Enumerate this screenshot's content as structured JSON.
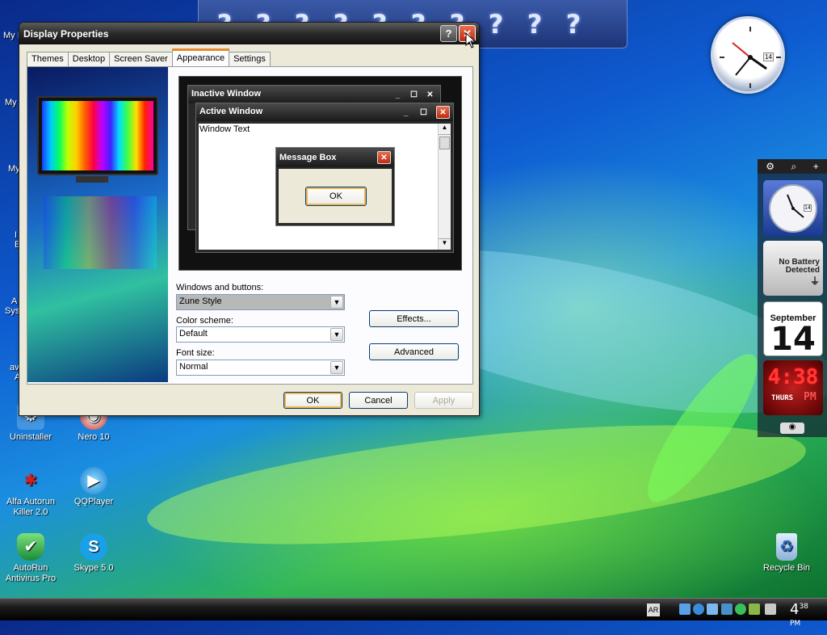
{
  "dialog": {
    "title": "Display Properties",
    "help_glyph": "?",
    "close_glyph": "✕",
    "tabs": [
      {
        "label": "Themes"
      },
      {
        "label": "Desktop"
      },
      {
        "label": "Screen Saver"
      },
      {
        "label": "Appearance",
        "active": true
      },
      {
        "label": "Settings"
      }
    ],
    "preview": {
      "inactive_title": "Inactive Window",
      "active_title": "Active Window",
      "window_text": "Window Text",
      "messagebox_title": "Message Box",
      "messagebox_ok": "OK"
    },
    "windows_buttons": {
      "label": "Windows and buttons:",
      "value": "Zune Style"
    },
    "color_scheme": {
      "label": "Color scheme:",
      "value": "Default"
    },
    "font_size": {
      "label": "Font size:",
      "value": "Normal"
    },
    "effects_label": "Effects...",
    "advanced_label": "Advanced",
    "ok_label": "OK",
    "cancel_label": "Cancel",
    "apply_label": "Apply"
  },
  "topbar": {
    "glyphs": [
      "?",
      "?",
      "?",
      "?",
      "?",
      "?",
      "?",
      "?",
      "?",
      "?"
    ]
  },
  "desktop_icons": [
    {
      "label": "Uninstaller",
      "icon": "uninstaller-icon"
    },
    {
      "label": "Nero 10",
      "icon": "nero-icon"
    },
    {
      "label": "Alfa Autorun Killer 2.0",
      "icon": "alfa-autorun-icon"
    },
    {
      "label": "QQPlayer",
      "icon": "qqplayer-icon"
    },
    {
      "label": "AutoRun Antivirus Pro",
      "icon": "autorun-antivirus-icon"
    },
    {
      "label": "Skype 5.0",
      "icon": "skype-icon"
    },
    {
      "label": "Recycle Bin",
      "icon": "recycle-bin-icon"
    }
  ],
  "cut_labels": [
    "My I",
    "My",
    "My",
    "I",
    "E",
    "A",
    "Sys",
    "av",
    "A"
  ],
  "gadgets": {
    "clock_date": "14",
    "battery_text": "No Battery Detected",
    "calendar_month": "September",
    "calendar_day": "14",
    "digital_time": "4:38",
    "digital_day": "THURS",
    "digital_ampm": "PM"
  },
  "taskbar": {
    "lang": "AR",
    "time_hour": "4",
    "time_minutes": "38",
    "time_ampm": "PM"
  },
  "colors": {
    "title_dark": "#2b2b2b",
    "close_red": "#c02a10",
    "tab_accent": "#e68b2c",
    "dialog_bg": "#ece9d8"
  }
}
